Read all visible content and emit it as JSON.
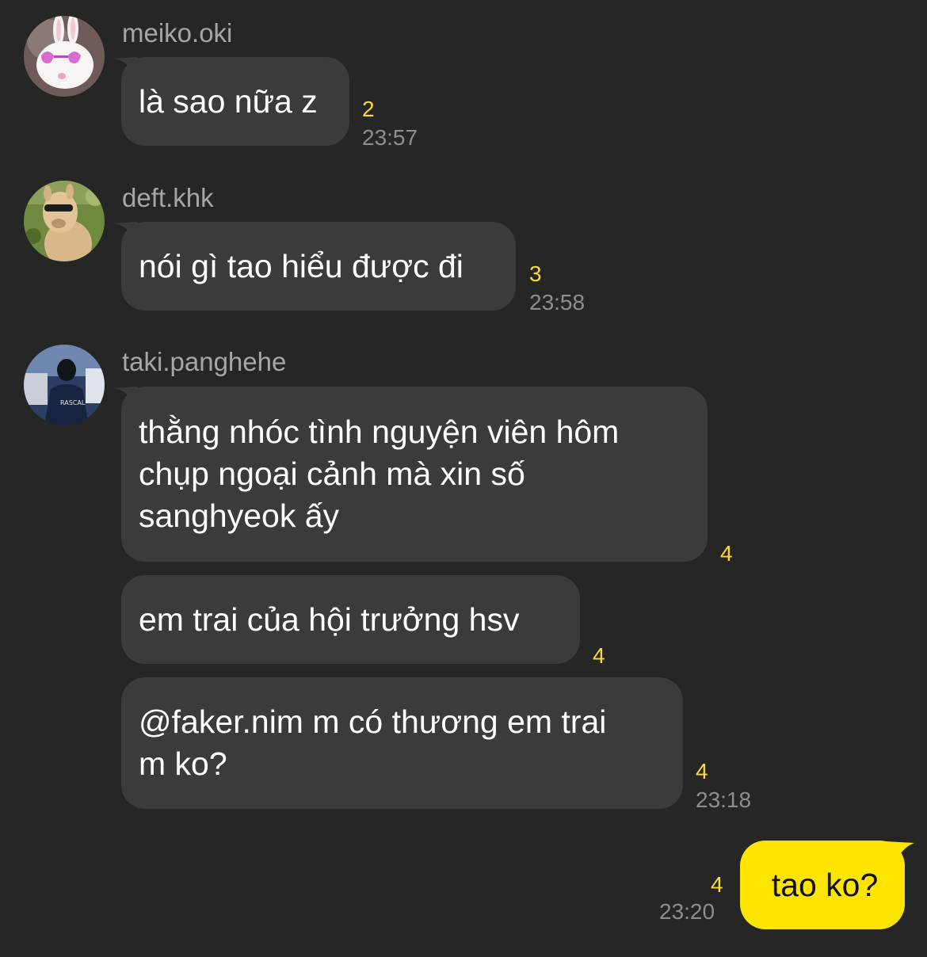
{
  "theme": {
    "background": "#262627",
    "bubble_other": "#3b3b3d",
    "bubble_mine": "#fde500",
    "unread_color": "#fcd93b",
    "muted_text": "#a6a6a8"
  },
  "messages": [
    {
      "sender": "meiko.oki",
      "avatar": "bunny-sunglasses-avatar",
      "bubbles": [
        {
          "text": "là sao nữa z",
          "unread": "2",
          "time": "23:57"
        }
      ]
    },
    {
      "sender": "deft.khk",
      "avatar": "alpaca-sunglasses-avatar",
      "bubbles": [
        {
          "text": "nói gì tao hiểu được đi",
          "unread": "3",
          "time": "23:58"
        }
      ]
    },
    {
      "sender": "taki.panghehe",
      "avatar": "person-in-rascal-jacket-avatar",
      "bubbles": [
        {
          "text": "thằng nhóc tình nguyện viên hôm\nchụp ngoại cảnh mà xin số\nsanghyeok ấy",
          "unread": "4"
        },
        {
          "text": "em trai của hội trưởng hsv",
          "unread": "4"
        },
        {
          "text": "@faker.nim m có thương em trai\nm ko?",
          "unread": "4",
          "time": "23:18"
        }
      ]
    }
  ],
  "my_message": {
    "text": "tao ko?",
    "unread": "4",
    "time": "23:20"
  },
  "avatar_labels": {
    "jacket_text": "RASCAL"
  }
}
